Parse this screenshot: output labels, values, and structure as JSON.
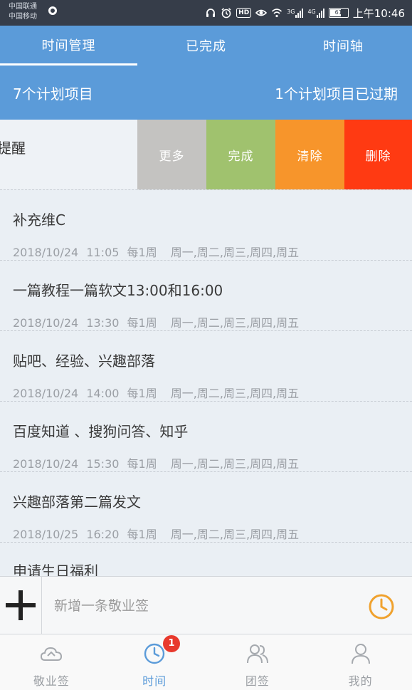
{
  "status_bar": {
    "carrier_1": "中国联通",
    "carrier_2": "中国移动",
    "net_3g": "3G",
    "net_4g": "4G",
    "battery": "61",
    "time": "上午10:46"
  },
  "tabs": [
    {
      "label": "时间管理",
      "active": true
    },
    {
      "label": "已完成",
      "active": false
    },
    {
      "label": "时间轴",
      "active": false
    }
  ],
  "summary": {
    "count_text": "7个计划项目",
    "expired_text": "1个计划项目已过期"
  },
  "swiped_row": {
    "title": "提醒",
    "actions": {
      "more": "更多",
      "done": "完成",
      "clear": "清除",
      "delete": "删除"
    },
    "colors": {
      "more": "#c4c3c1",
      "done": "#a0c26e",
      "clear": "#f7952b",
      "delete": "#ff3a12"
    }
  },
  "items": [
    {
      "title": "补充维C",
      "date": "2018/10/24",
      "time": "11:05",
      "repeat": "每1周",
      "days": "周一,周二,周三,周四,周五"
    },
    {
      "title": "一篇教程一篇软文13:00和16:00",
      "date": "2018/10/24",
      "time": "13:30",
      "repeat": "每1周",
      "days": "周一,周二,周三,周四,周五"
    },
    {
      "title": "贴吧、经验、兴趣部落",
      "date": "2018/10/24",
      "time": "14:00",
      "repeat": "每1周",
      "days": "周一,周二,周三,周四,周五"
    },
    {
      "title": "百度知道 、搜狗问答、知乎",
      "date": "2018/10/24",
      "time": "15:30",
      "repeat": "每1周",
      "days": "周一,周二,周三,周四,周五"
    },
    {
      "title": "兴趣部落第二篇发文",
      "date": "2018/10/25",
      "time": "16:20",
      "repeat": "每1周",
      "days": "周一,周二,周三,周四,周五"
    },
    {
      "title": "申请生日福利",
      "date": "",
      "time": "",
      "repeat": "",
      "days": ""
    }
  ],
  "add_bar": {
    "placeholder": "新增一条敬业签",
    "icons": {
      "add": "plus-icon",
      "reminder": "clock-icon"
    },
    "accent": "#f0a22e"
  },
  "bottom_nav": {
    "items": [
      {
        "label": "敬业签",
        "icon": "cloud-note-icon"
      },
      {
        "label": "时间",
        "icon": "clock-icon"
      },
      {
        "label": "团签",
        "icon": "group-icon"
      },
      {
        "label": "我的",
        "icon": "person-icon"
      }
    ],
    "active_index": 1,
    "badge": "1",
    "badge_color": "#e8392d"
  },
  "colors": {
    "primary": "#5b9bd9",
    "status_bar": "#363d49",
    "background": "#eaeff4"
  }
}
